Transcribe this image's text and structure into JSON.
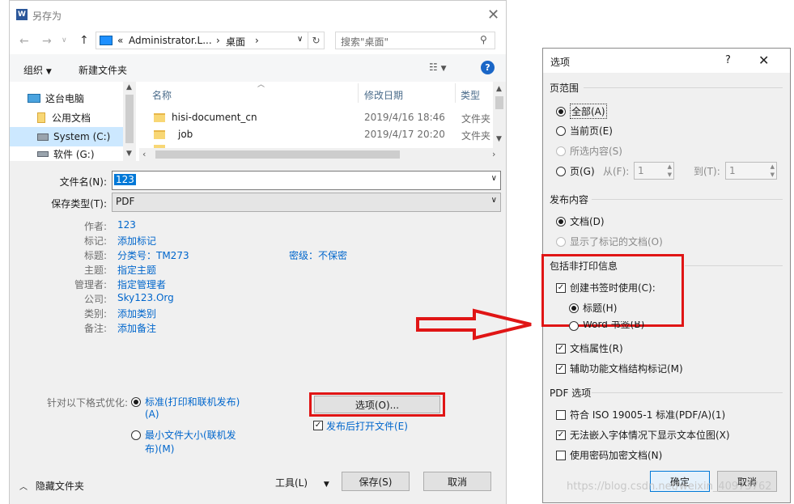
{
  "save_dialog": {
    "title": "另存为",
    "address": {
      "path_prefix": "«",
      "path_1": "Administrator.L...",
      "path_2": "桌面",
      "search_placeholder": "搜索\"桌面\""
    },
    "toolbar": {
      "organize": "组织",
      "new_folder": "新建文件夹"
    },
    "tree": [
      {
        "label": "这台电脑"
      },
      {
        "label": "公用文档"
      },
      {
        "label": "System (C:)"
      },
      {
        "label": "软件 (G:)"
      }
    ],
    "columns": {
      "name": "名称",
      "date": "修改日期",
      "type": "类型"
    },
    "files": [
      {
        "name": "hisi-document_cn",
        "date": "2019/4/16 18:46",
        "type": "文件夹"
      },
      {
        "name": "job",
        "date": "2019/4/17 20:20",
        "type": "文件夹"
      }
    ],
    "filename_label": "文件名(N):",
    "filename_value": "123",
    "filetype_label": "保存类型(T):",
    "filetype_value": "PDF",
    "meta": {
      "author_label": "作者:",
      "author": "123",
      "tags_label": "标记:",
      "tags": "添加标记",
      "title_label": "标题:",
      "title": "分类号：TM273",
      "secret": "密级：不保密",
      "subject_label": "主题:",
      "subject": "指定主题",
      "manager_label": "管理者:",
      "manager": "指定管理者",
      "company_label": "公司:",
      "company": "Sky123.Org",
      "category_label": "类别:",
      "category": "添加类别",
      "notes_label": "备注:",
      "notes": "添加备注"
    },
    "optimize_label": "针对以下格式优化:",
    "optimize_standard_1": "标准(打印和联机发布)",
    "optimize_standard_2": "(A)",
    "optimize_min_1": "最小文件大小(联机发",
    "optimize_min_2": "布)(M)",
    "options_button": "选项(O)...",
    "open_after": "发布后打开文件(E)",
    "hide_folders": "隐藏文件夹",
    "tools": "工具(L)",
    "save": "保存(S)",
    "cancel": "取消"
  },
  "options_dialog": {
    "title": "选项",
    "help": "?",
    "page_range": "页范围",
    "all": "全部(A)",
    "current_page": "当前页(E)",
    "selection": "所选内容(S)",
    "pages": "页(G)",
    "from_label": "从(F):",
    "from_value": "1",
    "to_label": "到(T):",
    "to_value": "1",
    "publish_what": "发布内容",
    "document": "文档(D)",
    "markup_doc": "显示了标记的文档(O)",
    "non_print": "包括非打印信息",
    "create_bookmarks": "创建书签时使用(C):",
    "headings": "标题(H)",
    "word_bookmarks": "Word 书签(B)",
    "doc_props": "文档属性(R)",
    "struct_tags": "辅助功能文档结构标记(M)",
    "pdf_options": "PDF 选项",
    "iso": "符合 ISO 19005-1 标准(PDF/A)(1)",
    "bitmap": "无法嵌入字体情况下显示文本位图(X)",
    "encrypt": "使用密码加密文档(N)",
    "ok": "确定",
    "cancel": "取消"
  },
  "watermark": "https://blog.csdn.net/weixin_40973762",
  "colors": {
    "red_highlight": "#e01515",
    "link_blue": "#0066cc",
    "selection_blue": "#cce8ff"
  }
}
